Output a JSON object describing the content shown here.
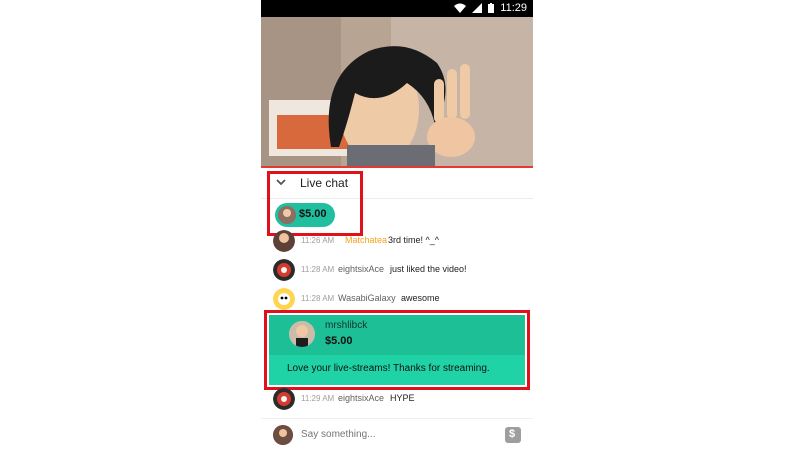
{
  "status_bar": {
    "time": "11:29"
  },
  "chat": {
    "title": "Live chat",
    "ticker_amount": "$5.00",
    "input_placeholder": "Say something..."
  },
  "messages": [
    {
      "time": "11:26 AM",
      "author": "Matchatea",
      "text": "3rd time! ^_^"
    },
    {
      "time": "11:28 AM",
      "author": "eightsixAce",
      "text": "just liked the video!"
    },
    {
      "time": "11:28 AM",
      "author": "WasabiGalaxy",
      "text": "awesome"
    },
    {
      "time": "11:29 AM",
      "author": "eightsixAce",
      "text": "HYPE"
    }
  ],
  "superchat": {
    "author": "mrshlibck",
    "amount": "$5.00",
    "text": "Love your live-streams! Thanks for streaming."
  },
  "colors": {
    "highlight_red": "#e1111b",
    "superchat_green": "#1dbf96",
    "superchat_green_light": "#1fd3a6",
    "ticker_green": "#1fbf9f",
    "username_orange": "#f6a21e"
  },
  "icons": [
    "signal-icon",
    "wifi-icon",
    "battery-icon",
    "chevron-down-icon",
    "dollar-icon"
  ]
}
